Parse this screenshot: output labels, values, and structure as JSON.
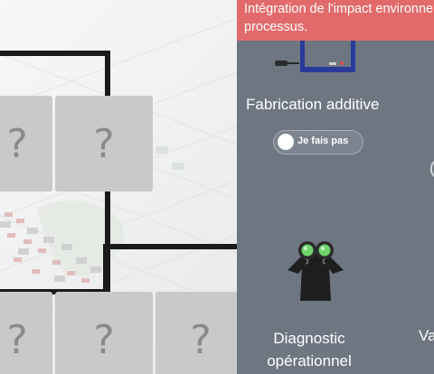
{
  "banner": {
    "line1": "Intégration de l'impact environnemental",
    "line2": "processus."
  },
  "cards": {
    "hidden_symbol": "?"
  },
  "panel": {
    "item1": {
      "title": "Fabrication additive",
      "toggle_label": "Je fais pas",
      "toggle_on": false
    },
    "item2": {
      "label": "Diagnostic opérationnel"
    },
    "item3_partial_label": "Va"
  },
  "colors": {
    "panel_bg": "#6e7682",
    "banner_bg": "#e26a6a",
    "card_bg": "#c9c9cb",
    "binocular_lens": "#6fd46c"
  },
  "icons": [
    "3d-printer-icon",
    "binoculars-icon"
  ]
}
